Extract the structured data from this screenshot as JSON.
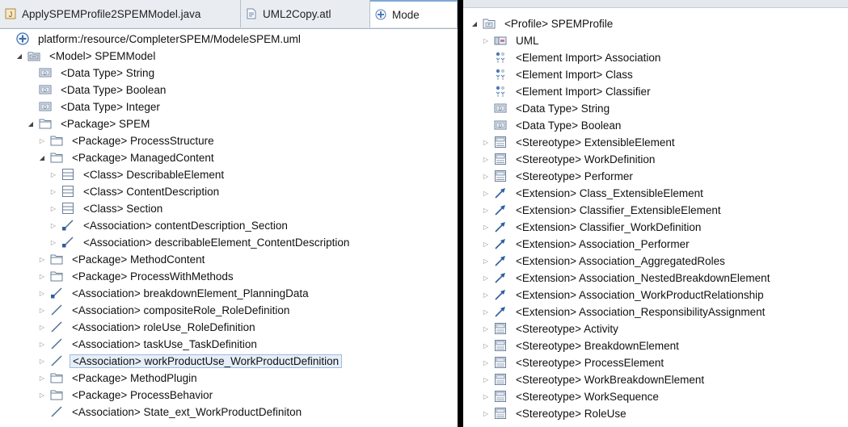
{
  "tabs": [
    {
      "label": "ApplySPEMProfile2SPEMModel.java",
      "icon": "java-file-icon"
    },
    {
      "label": "UML2Copy.atl",
      "icon": "atl-file-icon"
    },
    {
      "label": "Mode",
      "icon": "uml-model-icon"
    }
  ],
  "left_tree": [
    {
      "label": "platform:/resource/CompleterSPEM/ModeleSPEM.uml",
      "icon": "resource-icon",
      "indent": 0,
      "twisty": "none"
    },
    {
      "label": "<Model> SPEMModel",
      "icon": "model-icon",
      "indent": 1,
      "twisty": "expanded"
    },
    {
      "label": "<Data Type> String",
      "icon": "datatype-icon",
      "indent": 2,
      "twisty": "none"
    },
    {
      "label": "<Data Type> Boolean",
      "icon": "datatype-icon",
      "indent": 2,
      "twisty": "none"
    },
    {
      "label": "<Data Type> Integer",
      "icon": "datatype-icon",
      "indent": 2,
      "twisty": "none"
    },
    {
      "label": "<Package> SPEM",
      "icon": "package-icon",
      "indent": 2,
      "twisty": "expanded"
    },
    {
      "label": "<Package> ProcessStructure",
      "icon": "package-icon",
      "indent": 3,
      "twisty": "collapsed"
    },
    {
      "label": "<Package> ManagedContent",
      "icon": "package-icon",
      "indent": 3,
      "twisty": "expanded"
    },
    {
      "label": "<Class> DescribableElement",
      "icon": "class-icon",
      "indent": 4,
      "twisty": "collapsed"
    },
    {
      "label": "<Class> ContentDescription",
      "icon": "class-icon",
      "indent": 4,
      "twisty": "collapsed"
    },
    {
      "label": "<Class> Section",
      "icon": "class-icon",
      "indent": 4,
      "twisty": "collapsed"
    },
    {
      "label": "<Association> contentDescription_Section",
      "icon": "association-directed-icon",
      "indent": 4,
      "twisty": "collapsed"
    },
    {
      "label": "<Association> describableElement_ContentDescription",
      "icon": "association-directed-icon",
      "indent": 4,
      "twisty": "collapsed"
    },
    {
      "label": "<Package> MethodContent",
      "icon": "package-icon",
      "indent": 3,
      "twisty": "collapsed"
    },
    {
      "label": "<Package> ProcessWithMethods",
      "icon": "package-icon",
      "indent": 3,
      "twisty": "collapsed"
    },
    {
      "label": "<Association> breakdownElement_PlanningData",
      "icon": "association-directed-icon",
      "indent": 3,
      "twisty": "collapsed"
    },
    {
      "label": "<Association> compositeRole_RoleDefinition",
      "icon": "association-icon",
      "indent": 3,
      "twisty": "collapsed"
    },
    {
      "label": "<Association> roleUse_RoleDefinition",
      "icon": "association-icon",
      "indent": 3,
      "twisty": "collapsed"
    },
    {
      "label": "<Association> taskUse_TaskDefinition",
      "icon": "association-icon",
      "indent": 3,
      "twisty": "collapsed"
    },
    {
      "label": "<Association> workProductUse_WorkProductDefinition",
      "icon": "association-icon",
      "indent": 3,
      "twisty": "collapsed",
      "selected": true
    },
    {
      "label": "<Package> MethodPlugin",
      "icon": "package-icon",
      "indent": 3,
      "twisty": "collapsed"
    },
    {
      "label": "<Package> ProcessBehavior",
      "icon": "package-icon",
      "indent": 3,
      "twisty": "collapsed"
    },
    {
      "label": "<Association> State_ext_WorkProductDefiniton",
      "icon": "association-icon",
      "indent": 3,
      "twisty": "none"
    }
  ],
  "right_tree": [
    {
      "label": "<Profile> SPEMProfile",
      "icon": "profile-icon",
      "indent": 0,
      "twisty": "expanded"
    },
    {
      "label": "UML",
      "icon": "uml-library-icon",
      "indent": 1,
      "twisty": "collapsed"
    },
    {
      "label": "<Element Import> Association",
      "icon": "element-import-icon",
      "indent": 1,
      "twisty": "none"
    },
    {
      "label": "<Element Import> Class",
      "icon": "element-import-icon",
      "indent": 1,
      "twisty": "none"
    },
    {
      "label": "<Element Import> Classifier",
      "icon": "element-import-icon",
      "indent": 1,
      "twisty": "none"
    },
    {
      "label": "<Data Type> String",
      "icon": "datatype-icon",
      "indent": 1,
      "twisty": "none"
    },
    {
      "label": "<Data Type> Boolean",
      "icon": "datatype-icon",
      "indent": 1,
      "twisty": "none"
    },
    {
      "label": "<Stereotype> ExtensibleElement",
      "icon": "stereotype-icon",
      "indent": 1,
      "twisty": "collapsed"
    },
    {
      "label": "<Stereotype> WorkDefinition",
      "icon": "stereotype-icon",
      "indent": 1,
      "twisty": "collapsed"
    },
    {
      "label": "<Stereotype> Performer",
      "icon": "stereotype-icon",
      "indent": 1,
      "twisty": "collapsed"
    },
    {
      "label": "<Extension> Class_ExtensibleElement",
      "icon": "extension-icon",
      "indent": 1,
      "twisty": "collapsed"
    },
    {
      "label": "<Extension> Classifier_ExtensibleElement",
      "icon": "extension-icon",
      "indent": 1,
      "twisty": "collapsed"
    },
    {
      "label": "<Extension> Classifier_WorkDefinition",
      "icon": "extension-icon",
      "indent": 1,
      "twisty": "collapsed"
    },
    {
      "label": "<Extension> Association_Performer",
      "icon": "extension-icon",
      "indent": 1,
      "twisty": "collapsed"
    },
    {
      "label": "<Extension> Association_AggregatedRoles",
      "icon": "extension-icon",
      "indent": 1,
      "twisty": "collapsed"
    },
    {
      "label": "<Extension> Association_NestedBreakdownElement",
      "icon": "extension-icon",
      "indent": 1,
      "twisty": "collapsed"
    },
    {
      "label": "<Extension> Association_WorkProductRelationship",
      "icon": "extension-icon",
      "indent": 1,
      "twisty": "collapsed"
    },
    {
      "label": "<Extension> Association_ResponsibilityAssignment",
      "icon": "extension-icon",
      "indent": 1,
      "twisty": "collapsed"
    },
    {
      "label": "<Stereotype> Activity",
      "icon": "stereotype-icon",
      "indent": 1,
      "twisty": "collapsed"
    },
    {
      "label": "<Stereotype> BreakdownElement",
      "icon": "stereotype-icon",
      "indent": 1,
      "twisty": "collapsed"
    },
    {
      "label": "<Stereotype> ProcessElement",
      "icon": "stereotype-icon",
      "indent": 1,
      "twisty": "collapsed"
    },
    {
      "label": "<Stereotype> WorkBreakdownElement",
      "icon": "stereotype-icon",
      "indent": 1,
      "twisty": "collapsed"
    },
    {
      "label": "<Stereotype> WorkSequence",
      "icon": "stereotype-icon",
      "indent": 1,
      "twisty": "collapsed"
    },
    {
      "label": "<Stereotype> RoleUse",
      "icon": "stereotype-icon",
      "indent": 1,
      "twisty": "collapsed"
    }
  ]
}
